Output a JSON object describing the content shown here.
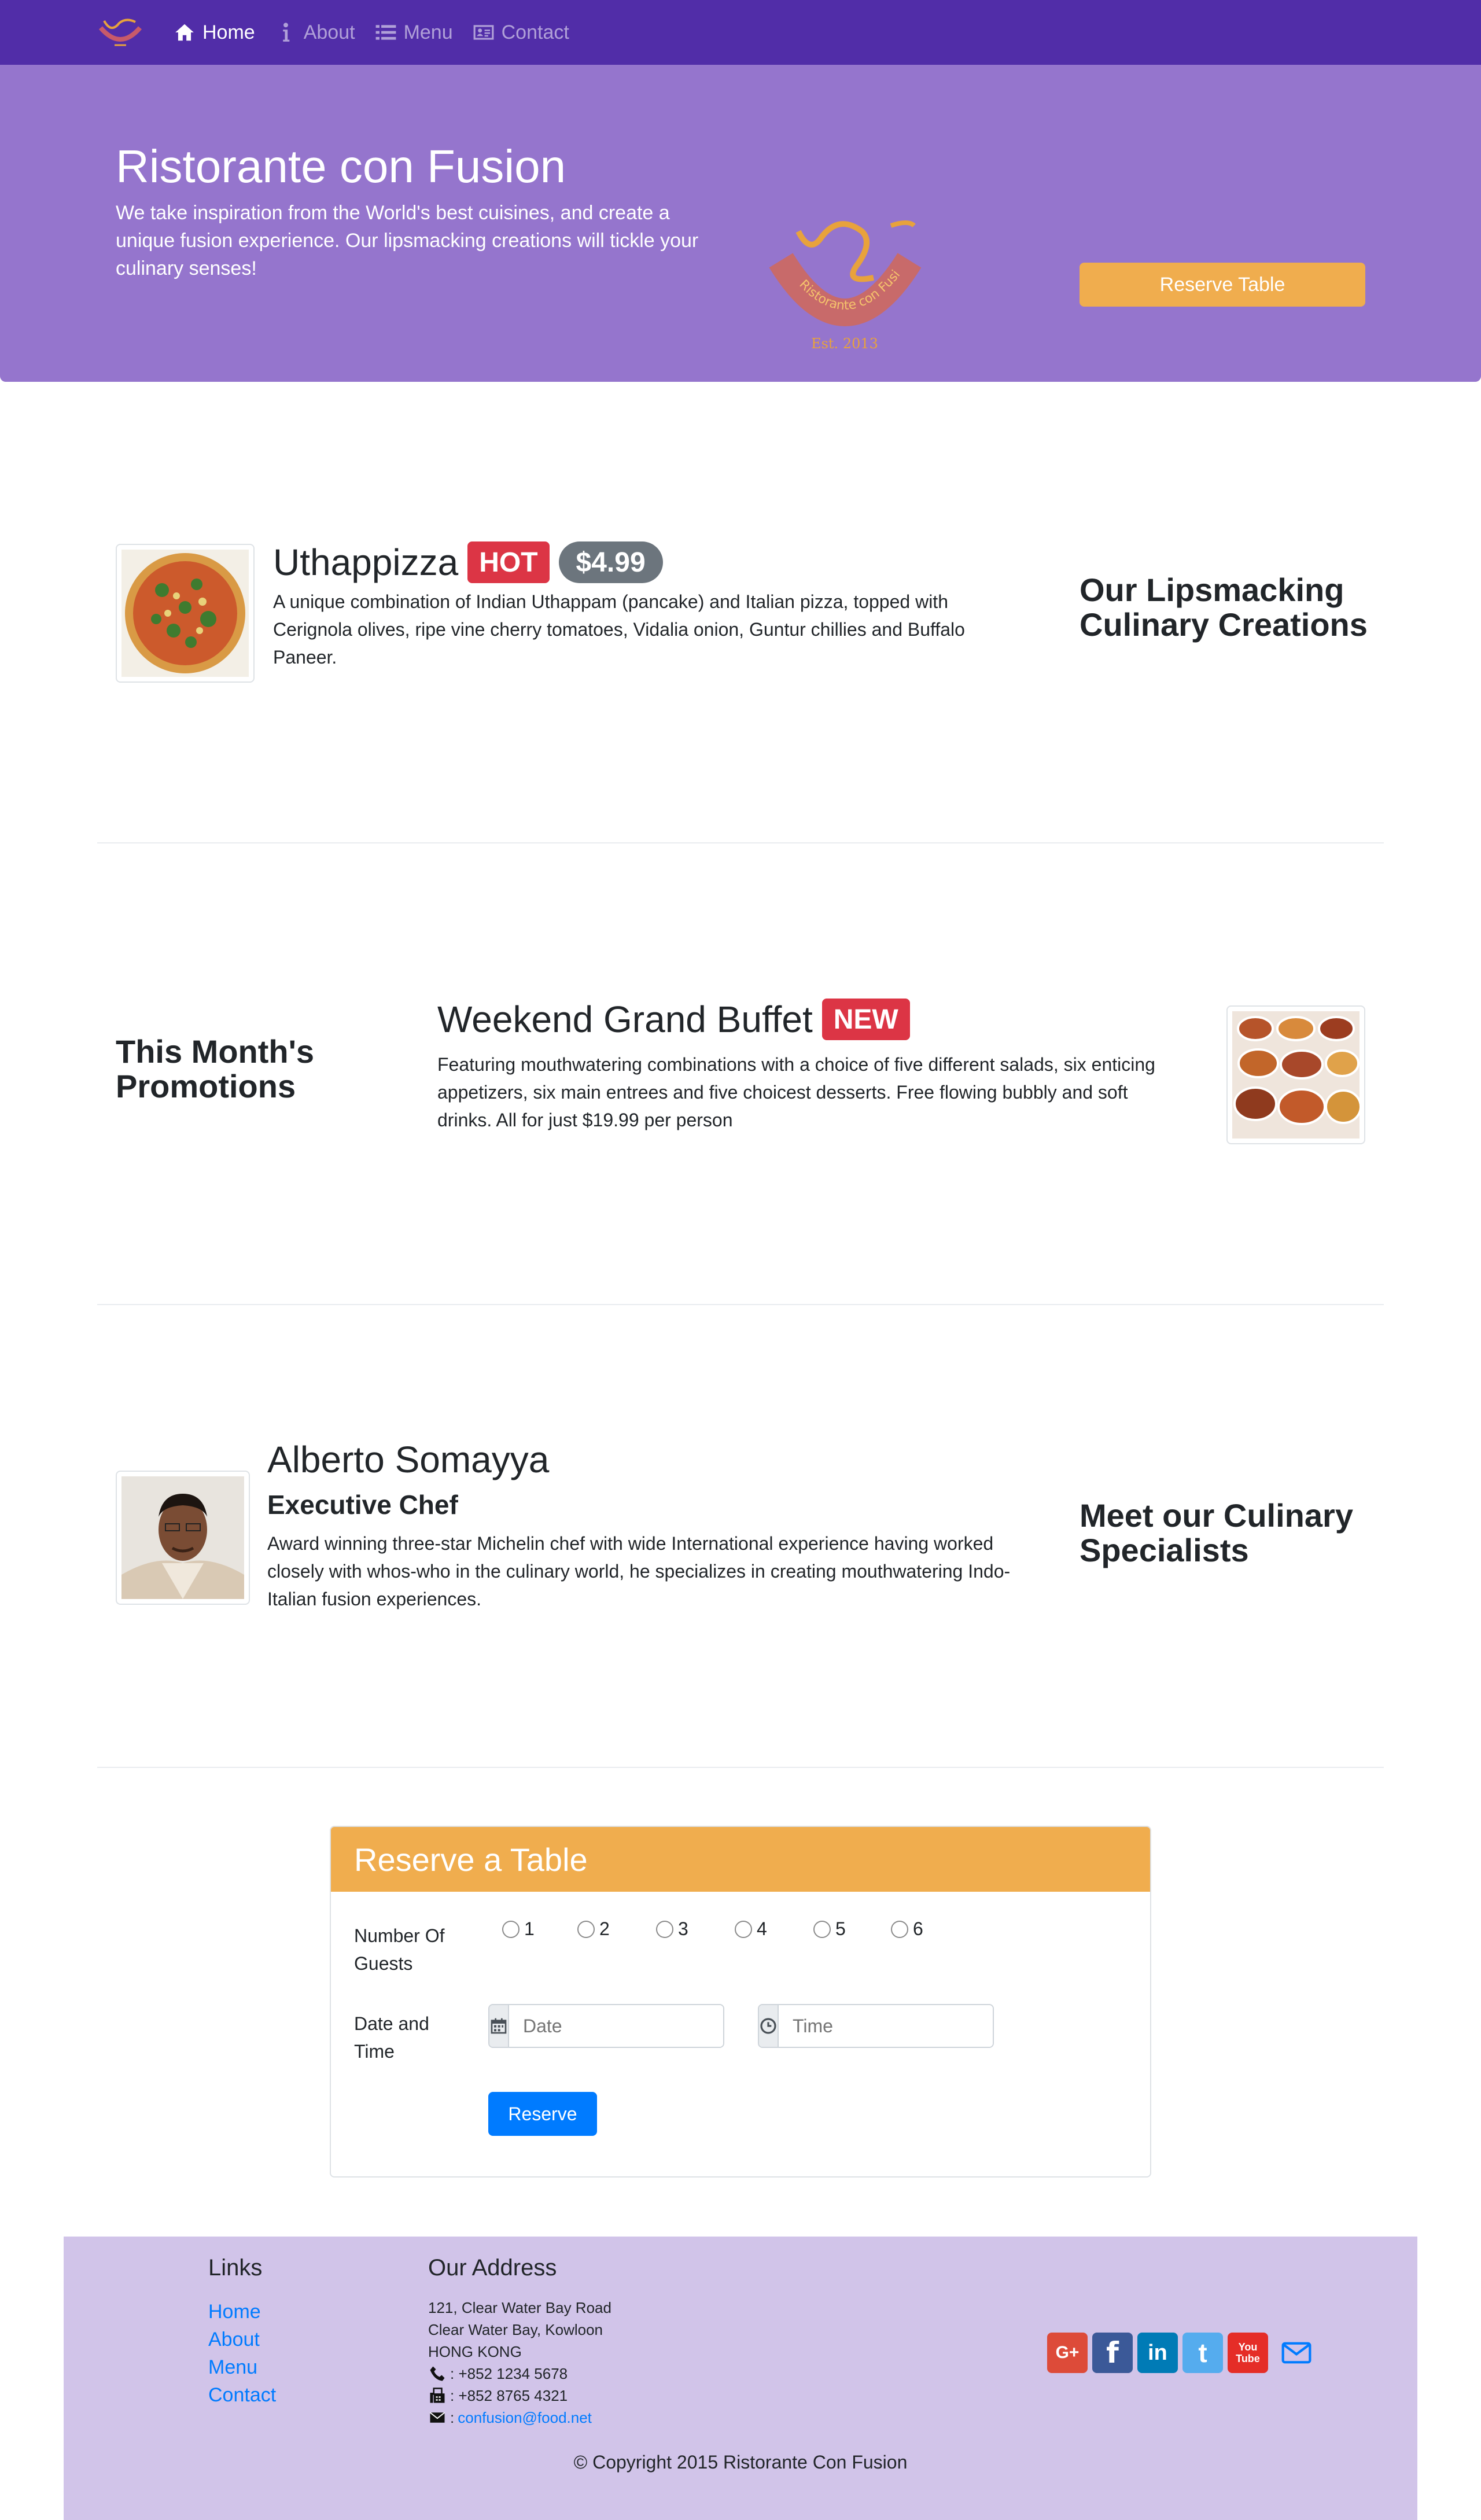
{
  "nav": {
    "items": [
      {
        "label": "Home",
        "icon": "home-icon",
        "active": true
      },
      {
        "label": "About",
        "icon": "info-icon"
      },
      {
        "label": "Menu",
        "icon": "list-icon"
      },
      {
        "label": "Contact",
        "icon": "address-card-icon"
      }
    ]
  },
  "jumbotron": {
    "title": "Ristorante con Fusion",
    "text": "We take inspiration from the World's best cuisines, and create a unique fusion experience. Our lipsmacking creations will tickle your culinary senses!",
    "logo_text": "Ristorante con Fusion",
    "logo_est": "Est. 2013",
    "reserve_button": "Reserve Table"
  },
  "dish": {
    "name": "Uthappizza",
    "badge": "HOT",
    "price": "$4.99",
    "description": "A unique combination of Indian Uthappam (pancake) and Italian pizza, topped with Cerignola olives, ripe vine cherry tomatoes, Vidalia onion, Guntur chillies and Buffalo Paneer.",
    "section_title": "Our Lipsmacking Culinary Creations"
  },
  "promotion": {
    "section_title": "This Month's Promotions",
    "name": "Weekend Grand Buffet",
    "badge": "NEW",
    "description": "Featuring mouthwatering combinations with a choice of five different salads, six enticing appetizers, six main entrees and five choicest desserts. Free flowing bubbly and soft drinks. All for just $19.99 per person"
  },
  "leader": {
    "name": "Alberto Somayya",
    "designation": "Executive Chef",
    "description": "Award winning three-star Michelin chef with wide International experience having worked closely with whos-who in the culinary world, he specializes in creating mouthwatering Indo-Italian fusion experiences.",
    "section_title": "Meet our Culinary Specialists"
  },
  "reserve": {
    "header": "Reserve a Table",
    "guests_label": "Number Of Guests",
    "guest_options": [
      "1",
      "2",
      "3",
      "4",
      "5",
      "6"
    ],
    "datetime_label": "Date and Time",
    "date_placeholder": "Date",
    "time_placeholder": "Time",
    "submit": "Reserve"
  },
  "footer": {
    "links_title": "Links",
    "links": [
      "Home",
      "About",
      "Menu",
      "Contact"
    ],
    "address_title": "Our Address",
    "address_lines": [
      "121, Clear Water Bay Road",
      "Clear Water Bay, Kowloon",
      "HONG KONG"
    ],
    "phone": ": +852 1234 5678",
    "fax": ": +852 8765 4321",
    "email": "confusion@food.net",
    "social": [
      {
        "name": "google-plus",
        "label": "G+",
        "color": "#dd4b39"
      },
      {
        "name": "facebook",
        "label": "f",
        "color": "#3b5998"
      },
      {
        "name": "linkedin",
        "label": "in",
        "color": "#007bb6"
      },
      {
        "name": "twitter",
        "label": "t",
        "color": "#55acee"
      },
      {
        "name": "youtube",
        "label": "You Tube",
        "color": "#e52d27"
      }
    ],
    "copyright": "© Copyright 2015 Ristorante Con Fusion"
  }
}
